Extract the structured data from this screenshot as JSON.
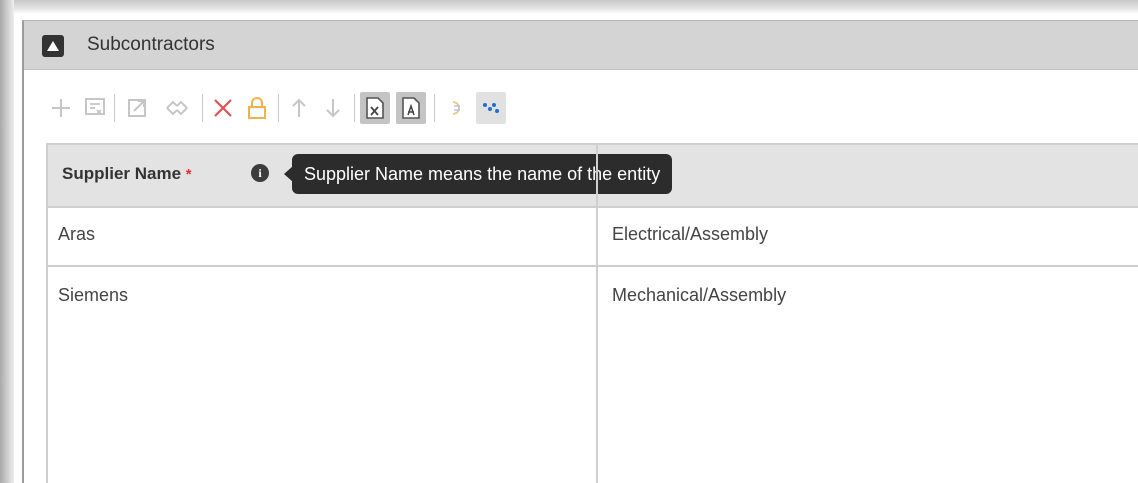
{
  "panel": {
    "title": "Subcontractors",
    "collapse_icon": "triangle-up-icon"
  },
  "toolbar": {
    "buttons": [
      {
        "name": "add-button",
        "icon": "plus-icon",
        "enabled": false
      },
      {
        "name": "select-button",
        "icon": "select-list-icon",
        "enabled": false
      },
      {
        "name": "open-button",
        "icon": "external-open-icon",
        "enabled": false
      },
      {
        "name": "unlink-button",
        "icon": "unlink-icon",
        "enabled": false
      },
      {
        "name": "delete-button",
        "icon": "x-icon",
        "enabled": false
      },
      {
        "name": "lock-button",
        "icon": "lock-icon",
        "enabled": false
      },
      {
        "name": "move-up-button",
        "icon": "arrow-up-icon",
        "enabled": false
      },
      {
        "name": "move-down-button",
        "icon": "arrow-down-icon",
        "enabled": false
      },
      {
        "name": "export-excel-button",
        "icon": "excel-file-icon",
        "enabled": true
      },
      {
        "name": "export-pdf-button",
        "icon": "pdf-file-icon",
        "enabled": true
      },
      {
        "name": "restore-button",
        "icon": "restore-icon",
        "enabled": false
      },
      {
        "name": "scatter-button",
        "icon": "scatter-dots-icon",
        "enabled": true
      }
    ]
  },
  "grid": {
    "columns": [
      {
        "label": "Supplier Name",
        "required_mark": "*",
        "info_glyph": "i"
      },
      {
        "label": ""
      }
    ],
    "tooltip": "Supplier Name means the name of the entity",
    "rows": [
      [
        "Aras",
        "Electrical/Assembly"
      ],
      [
        "Siemens",
        "Mechanical/Assembly"
      ]
    ]
  },
  "colors": {
    "header_bg": "#d4d4d4",
    "grid_border": "#cfcfcf",
    "required": "#e53030",
    "delete_red": "#e55050",
    "lock_orange": "#f1b24a",
    "accent_blue": "#1f6fd6",
    "tooltip_bg": "#2c2c2c"
  }
}
